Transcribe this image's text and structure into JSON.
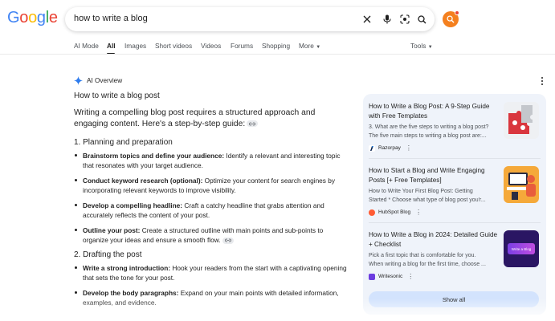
{
  "header": {
    "logo_text": "Google",
    "query": "how to write a blog",
    "icons": [
      "close-icon",
      "mic-icon",
      "lens-icon",
      "search-icon"
    ],
    "avatar_icon": "search-icon",
    "colors": {
      "blue": "#4285f4",
      "red": "#ea4335",
      "yellow": "#fbbc05",
      "green": "#34a853",
      "avatar": "#f4801f"
    }
  },
  "tabs": {
    "items": [
      "AI Mode",
      "All",
      "Images",
      "Short videos",
      "Videos",
      "Forums",
      "Shopping",
      "More"
    ],
    "active": "All",
    "tools": "Tools"
  },
  "ai_overview": {
    "label": "AI Overview",
    "title": "How to write a blog post",
    "intro": "Writing a compelling blog post requires a structured approach and engaging content. Here's a step-by-step guide:",
    "sections": [
      {
        "heading": "1. Planning and preparation",
        "items": [
          {
            "bold": "Brainstorm topics and define your audience:",
            "text": " Identify a relevant and interesting topic that resonates with your target audience."
          },
          {
            "bold": "Conduct keyword research (optional):",
            "text": " Optimize your content for search engines by incorporating relevant keywords to improve visibility."
          },
          {
            "bold": "Develop a compelling headline:",
            "text": " Craft a catchy headline that grabs attention and accurately reflects the content of your post."
          },
          {
            "bold": "Outline your post:",
            "text": " Create a structured outline with main points and sub-points to organize your ideas and ensure a smooth flow."
          }
        ]
      },
      {
        "heading": "2. Drafting the post",
        "items": [
          {
            "bold": "Write a strong introduction:",
            "text": " Hook your readers from the start with a captivating opening that sets the tone for your post."
          },
          {
            "bold": "Develop the body paragraphs:",
            "text": " Expand on your main points with detailed information, examples, and evidence."
          }
        ]
      }
    ]
  },
  "sources": {
    "cards": [
      {
        "title": "How to Write a Blog Post: A 9-Step Guide with Free Templates",
        "snippet1": "3. What are the five steps to writing a blog post?",
        "snippet2": "The five main steps to writing a blog post are:...",
        "source": "Razorpay",
        "source_color": "#0c2651"
      },
      {
        "title": "How to Start a Blog and Write Engaging Posts [+ Free Templates]",
        "snippet1": "How to Write Your First Blog Post: Getting",
        "snippet2": "Started * Choose what type of blog post you'r...",
        "source": "HubSpot Blog",
        "source_color": "#ff5c35"
      },
      {
        "title": "How to Write a Blog in 2024: Detailed Guide + Checklist",
        "snippet1": "Pick a first topic that is comfortable for you.",
        "snippet2": "When writing a blog for the first time, choose ...",
        "source": "Writesonic",
        "source_color": "#6c3ce0"
      }
    ],
    "show_all": "Show all",
    "thumb3_text": "Write a Blog"
  }
}
